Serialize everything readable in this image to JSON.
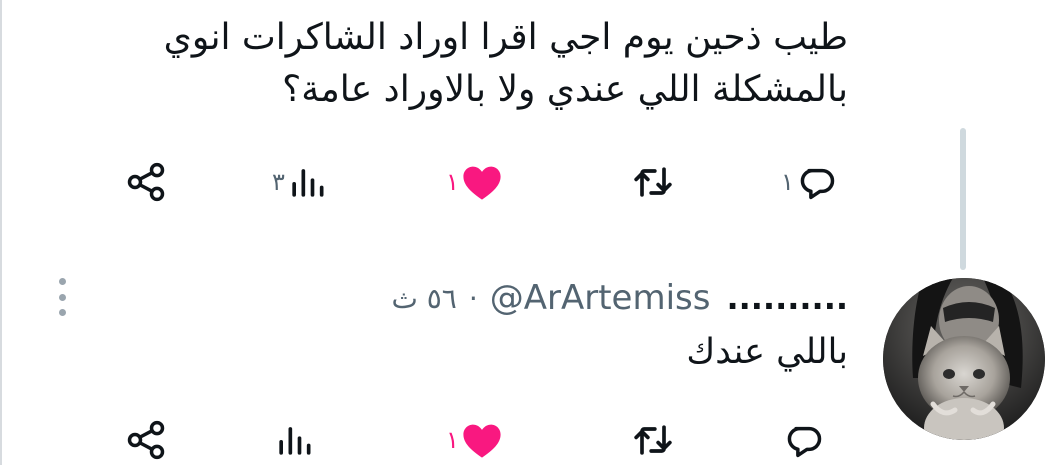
{
  "colors": {
    "text_primary": "#0f1419",
    "text_secondary": "#536471",
    "like_pink": "#f91880",
    "thread_line": "#cfd9de"
  },
  "tweet1": {
    "text_line1": "طيب ذحين يوم اجي اقرا اوراد الشاكرات انوي",
    "text_line2": "بالمشكلة اللي عندي ولا بالاوراد عامة؟",
    "actions": {
      "reply_count": "١",
      "retweet_count": "",
      "like_count": "١",
      "views_count": "٣",
      "liked": true
    },
    "icons": [
      "reply-icon",
      "retweet-icon",
      "heart-icon",
      "views-icon",
      "share-icon"
    ]
  },
  "tweet2": {
    "display_name": "..........",
    "handle": "@ArArtemiss",
    "separator": "·",
    "time": "٥٦ ث",
    "text": "باللي عندك",
    "actions": {
      "reply_count": "",
      "retweet_count": "",
      "like_count": "١",
      "views_count": "",
      "liked": true
    },
    "avatar": "avatar-cat-grayscale"
  },
  "more_icon": "more-vertical-icon"
}
